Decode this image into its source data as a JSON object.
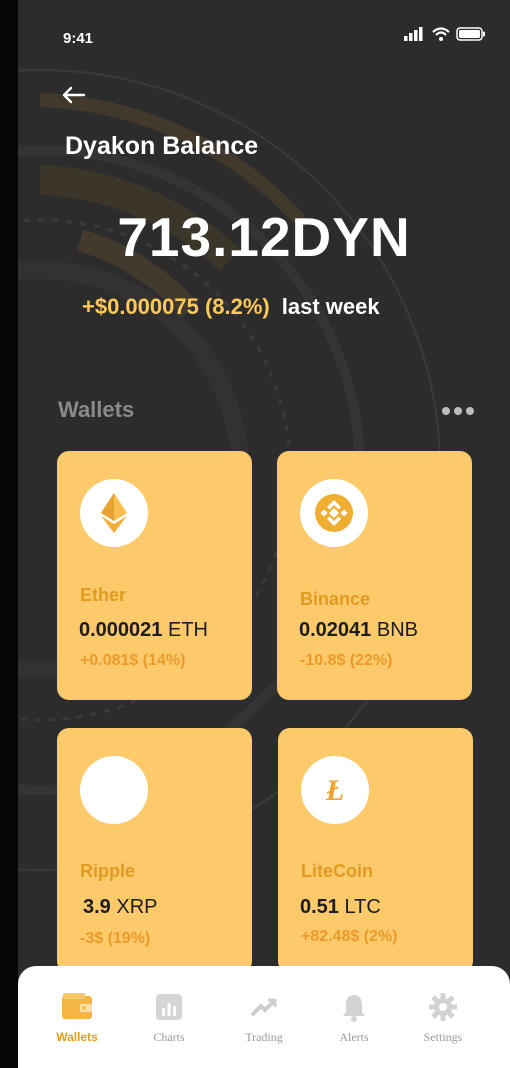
{
  "status_bar": {
    "time": "9:41"
  },
  "header": {
    "title": "Dyakon Balance"
  },
  "balance": {
    "amount": "713.12DYN",
    "change": "+$0.000075 (8.2%)",
    "period": "last week"
  },
  "wallets": {
    "label": "Wallets",
    "cards": [
      {
        "name": "Ether",
        "amount": "0.000021",
        "symbol": "ETH",
        "delta": "+0.081$ (14%)",
        "icon": "ethereum-icon"
      },
      {
        "name": "Binance",
        "amount": "0.02041",
        "symbol": "BNB",
        "delta": "-10.8$ (22%)",
        "icon": "binance-icon"
      },
      {
        "name": "Ripple",
        "amount": "3.9",
        "symbol": "XRP",
        "delta": "-3$ (19%)",
        "icon": "ripple-icon"
      },
      {
        "name": "LiteCoin",
        "amount": "0.51",
        "symbol": "LTC",
        "delta": "+82.48$ (2%)",
        "icon": "litecoin-icon"
      }
    ]
  },
  "nav": {
    "items": [
      {
        "label": "Wallets",
        "icon": "wallet-icon",
        "active": true
      },
      {
        "label": "Charts",
        "icon": "chart-icon"
      },
      {
        "label": "Trading",
        "icon": "trading-icon"
      },
      {
        "label": "Alerts",
        "icon": "bell-icon"
      },
      {
        "label": "Settings",
        "icon": "gear-icon"
      }
    ]
  },
  "colors": {
    "accent": "#fdca6b",
    "accent_text": "#e09b20",
    "background": "#2c2c2c"
  }
}
